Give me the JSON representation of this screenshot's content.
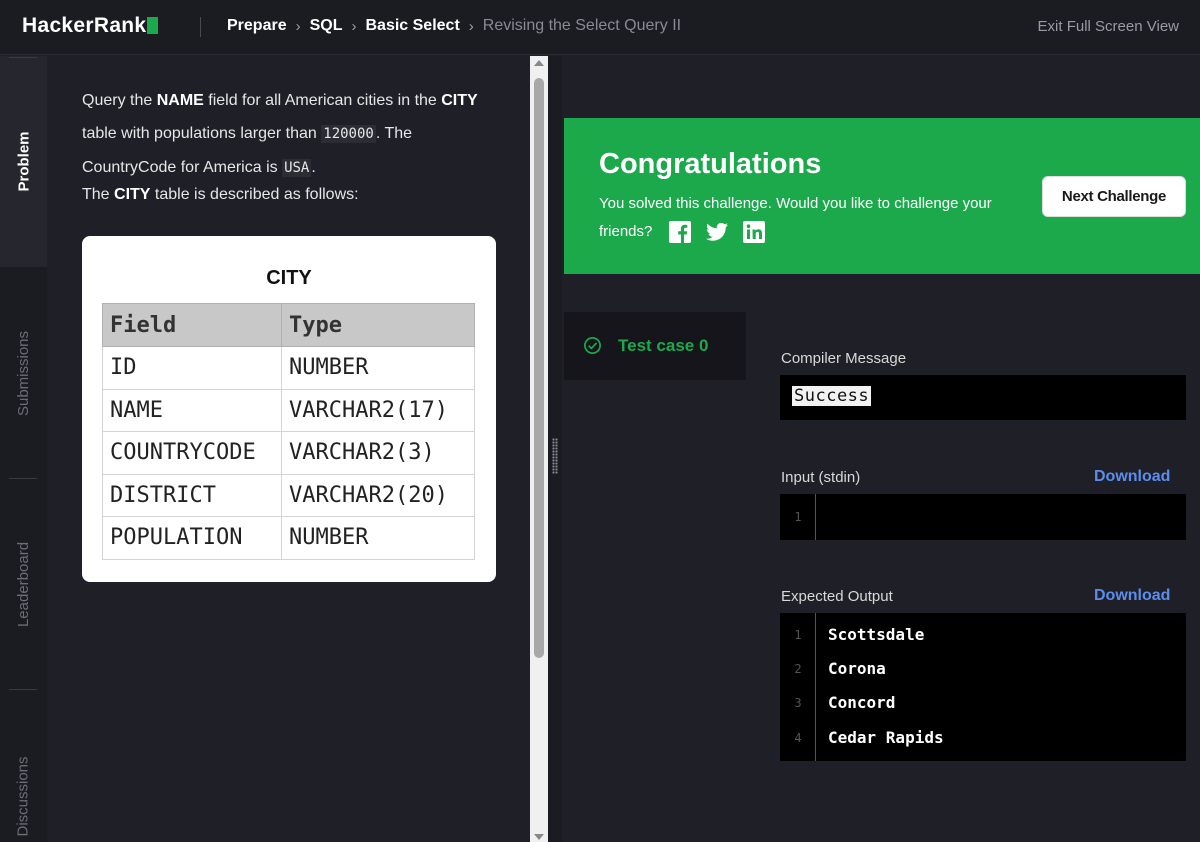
{
  "header": {
    "logo": "HackerRank",
    "breadcrumbs": [
      "Prepare",
      "SQL",
      "Basic Select"
    ],
    "current_page": "Revising the Select Query II",
    "exit_label": "Exit Full Screen View"
  },
  "rail": {
    "tabs": [
      "Problem",
      "Submissions",
      "Leaderboard",
      "Discussions"
    ]
  },
  "problem": {
    "p1_pre": "Query the ",
    "p1_field": "NAME",
    "p1_mid": " field for all American cities in the ",
    "p1_table": "CITY",
    "p1_mid2": " table with populations larger than ",
    "p1_pop": "120000",
    "p1_mid3": ". The CountryCode for America is ",
    "p1_code": "USA",
    "p1_end": ".",
    "p2_pre": "The ",
    "p2_table": "CITY",
    "p2_end": " table is described as follows:",
    "table_title": "CITY",
    "columns": [
      "Field",
      "Type"
    ],
    "rows": [
      [
        "ID",
        "NUMBER"
      ],
      [
        "NAME",
        "VARCHAR2(17)"
      ],
      [
        "COUNTRYCODE",
        "VARCHAR2(3)"
      ],
      [
        "DISTRICT",
        "VARCHAR2(20)"
      ],
      [
        "POPULATION",
        "NUMBER"
      ]
    ]
  },
  "result": {
    "title": "Congratulations",
    "subtitle": "You solved this challenge. Would you like to challenge your friends?",
    "share_icons": [
      "facebook-icon",
      "twitter-icon",
      "linkedin-icon"
    ],
    "next_button": "Next Challenge",
    "test_case": "Test case 0",
    "compiler_label": "Compiler Message",
    "compiler_message": "Success",
    "input_label": "Input (stdin)",
    "download_label": "Download",
    "input_lines": [
      "1"
    ],
    "expected_label": "Expected Output",
    "expected_lines": [
      "Scottsdale",
      "Corona",
      "Concord",
      "Cedar Rapids"
    ]
  },
  "colors": {
    "accent_green": "#1ba94c",
    "link_blue": "#5b8dee",
    "background": "#1f1f27"
  }
}
